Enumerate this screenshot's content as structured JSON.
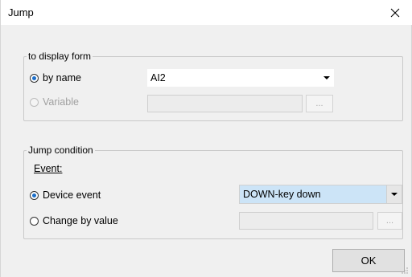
{
  "window": {
    "title": "Jump"
  },
  "display_form": {
    "legend": "to display form",
    "by_name": {
      "label": "by name",
      "checked": true,
      "value": "AI2"
    },
    "variable": {
      "label": "Variable",
      "checked": false,
      "enabled": false,
      "value": "",
      "browse_label": "..."
    }
  },
  "jump_condition": {
    "legend": "Jump condition",
    "event_label": "Event:",
    "device_event": {
      "label": "Device event",
      "checked": true,
      "value": "DOWN-key down"
    },
    "change_by_value": {
      "label": "Change by value",
      "checked": false,
      "value": "",
      "browse_label": "..."
    }
  },
  "buttons": {
    "ok_label": "OK"
  },
  "colors": {
    "title_bar": "#ffffff",
    "dialog_bg": "#f0f0f0",
    "selection_highlight": "#cce4f7",
    "radio_dot": "#1b6ec9"
  }
}
